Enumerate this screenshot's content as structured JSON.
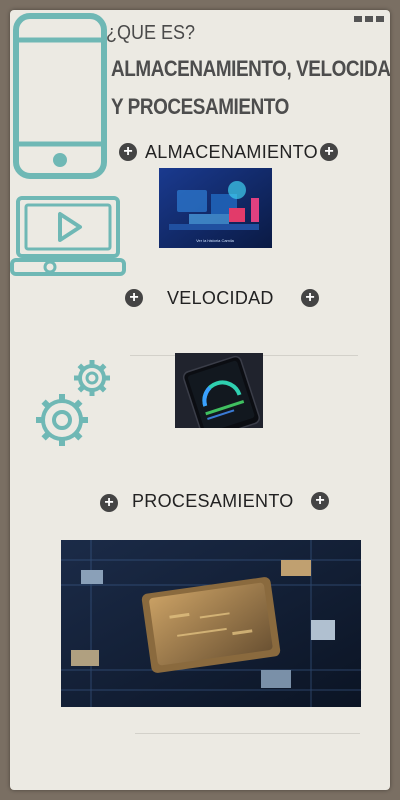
{
  "header": {
    "question": "¿QUE ES?",
    "title_line1": "ALMACENAMIENTO, VELOCIDAD",
    "title_line2": "Y PROCESAMIENTO"
  },
  "sections": {
    "storage": {
      "label": "ALMACENAMIENTO",
      "image_caption": "Ver la historia Camila"
    },
    "speed": {
      "label": "VELOCIDAD"
    },
    "processing": {
      "label": "PROCESAMIENTO"
    }
  },
  "icons": {
    "plus": "+",
    "phone": "smartphone-icon",
    "laptop": "laptop-play-icon",
    "gears": "gears-icon",
    "menu": "more-icon"
  },
  "colors": {
    "accent_teal": "#6fb8b5",
    "card_bg": "#eceae3",
    "page_bg": "#7a6f63"
  }
}
